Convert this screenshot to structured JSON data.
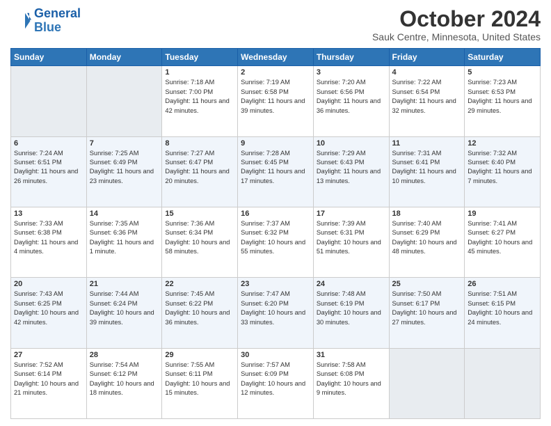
{
  "header": {
    "logo_line1": "General",
    "logo_line2": "Blue",
    "title": "October 2024",
    "subtitle": "Sauk Centre, Minnesota, United States"
  },
  "days_of_week": [
    "Sunday",
    "Monday",
    "Tuesday",
    "Wednesday",
    "Thursday",
    "Friday",
    "Saturday"
  ],
  "weeks": [
    [
      {
        "day": "",
        "info": ""
      },
      {
        "day": "",
        "info": ""
      },
      {
        "day": "1",
        "info": "Sunrise: 7:18 AM\nSunset: 7:00 PM\nDaylight: 11 hours and 42 minutes."
      },
      {
        "day": "2",
        "info": "Sunrise: 7:19 AM\nSunset: 6:58 PM\nDaylight: 11 hours and 39 minutes."
      },
      {
        "day": "3",
        "info": "Sunrise: 7:20 AM\nSunset: 6:56 PM\nDaylight: 11 hours and 36 minutes."
      },
      {
        "day": "4",
        "info": "Sunrise: 7:22 AM\nSunset: 6:54 PM\nDaylight: 11 hours and 32 minutes."
      },
      {
        "day": "5",
        "info": "Sunrise: 7:23 AM\nSunset: 6:53 PM\nDaylight: 11 hours and 29 minutes."
      }
    ],
    [
      {
        "day": "6",
        "info": "Sunrise: 7:24 AM\nSunset: 6:51 PM\nDaylight: 11 hours and 26 minutes."
      },
      {
        "day": "7",
        "info": "Sunrise: 7:25 AM\nSunset: 6:49 PM\nDaylight: 11 hours and 23 minutes."
      },
      {
        "day": "8",
        "info": "Sunrise: 7:27 AM\nSunset: 6:47 PM\nDaylight: 11 hours and 20 minutes."
      },
      {
        "day": "9",
        "info": "Sunrise: 7:28 AM\nSunset: 6:45 PM\nDaylight: 11 hours and 17 minutes."
      },
      {
        "day": "10",
        "info": "Sunrise: 7:29 AM\nSunset: 6:43 PM\nDaylight: 11 hours and 13 minutes."
      },
      {
        "day": "11",
        "info": "Sunrise: 7:31 AM\nSunset: 6:41 PM\nDaylight: 11 hours and 10 minutes."
      },
      {
        "day": "12",
        "info": "Sunrise: 7:32 AM\nSunset: 6:40 PM\nDaylight: 11 hours and 7 minutes."
      }
    ],
    [
      {
        "day": "13",
        "info": "Sunrise: 7:33 AM\nSunset: 6:38 PM\nDaylight: 11 hours and 4 minutes."
      },
      {
        "day": "14",
        "info": "Sunrise: 7:35 AM\nSunset: 6:36 PM\nDaylight: 11 hours and 1 minute."
      },
      {
        "day": "15",
        "info": "Sunrise: 7:36 AM\nSunset: 6:34 PM\nDaylight: 10 hours and 58 minutes."
      },
      {
        "day": "16",
        "info": "Sunrise: 7:37 AM\nSunset: 6:32 PM\nDaylight: 10 hours and 55 minutes."
      },
      {
        "day": "17",
        "info": "Sunrise: 7:39 AM\nSunset: 6:31 PM\nDaylight: 10 hours and 51 minutes."
      },
      {
        "day": "18",
        "info": "Sunrise: 7:40 AM\nSunset: 6:29 PM\nDaylight: 10 hours and 48 minutes."
      },
      {
        "day": "19",
        "info": "Sunrise: 7:41 AM\nSunset: 6:27 PM\nDaylight: 10 hours and 45 minutes."
      }
    ],
    [
      {
        "day": "20",
        "info": "Sunrise: 7:43 AM\nSunset: 6:25 PM\nDaylight: 10 hours and 42 minutes."
      },
      {
        "day": "21",
        "info": "Sunrise: 7:44 AM\nSunset: 6:24 PM\nDaylight: 10 hours and 39 minutes."
      },
      {
        "day": "22",
        "info": "Sunrise: 7:45 AM\nSunset: 6:22 PM\nDaylight: 10 hours and 36 minutes."
      },
      {
        "day": "23",
        "info": "Sunrise: 7:47 AM\nSunset: 6:20 PM\nDaylight: 10 hours and 33 minutes."
      },
      {
        "day": "24",
        "info": "Sunrise: 7:48 AM\nSunset: 6:19 PM\nDaylight: 10 hours and 30 minutes."
      },
      {
        "day": "25",
        "info": "Sunrise: 7:50 AM\nSunset: 6:17 PM\nDaylight: 10 hours and 27 minutes."
      },
      {
        "day": "26",
        "info": "Sunrise: 7:51 AM\nSunset: 6:15 PM\nDaylight: 10 hours and 24 minutes."
      }
    ],
    [
      {
        "day": "27",
        "info": "Sunrise: 7:52 AM\nSunset: 6:14 PM\nDaylight: 10 hours and 21 minutes."
      },
      {
        "day": "28",
        "info": "Sunrise: 7:54 AM\nSunset: 6:12 PM\nDaylight: 10 hours and 18 minutes."
      },
      {
        "day": "29",
        "info": "Sunrise: 7:55 AM\nSunset: 6:11 PM\nDaylight: 10 hours and 15 minutes."
      },
      {
        "day": "30",
        "info": "Sunrise: 7:57 AM\nSunset: 6:09 PM\nDaylight: 10 hours and 12 minutes."
      },
      {
        "day": "31",
        "info": "Sunrise: 7:58 AM\nSunset: 6:08 PM\nDaylight: 10 hours and 9 minutes."
      },
      {
        "day": "",
        "info": ""
      },
      {
        "day": "",
        "info": ""
      }
    ]
  ]
}
